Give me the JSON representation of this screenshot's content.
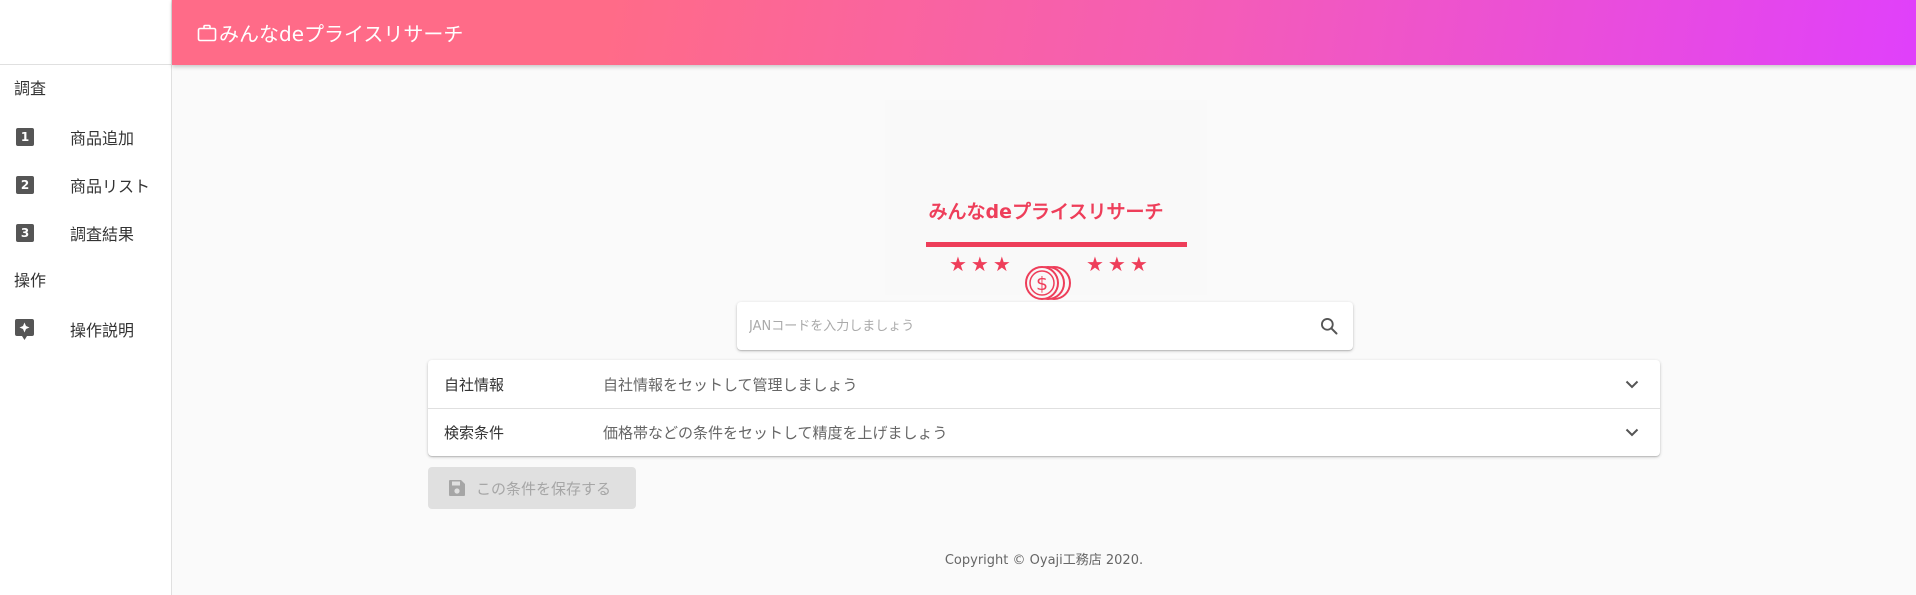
{
  "app": {
    "title": "みんなdeプライスリサーチ"
  },
  "colors": {
    "header_gradient_start": "#ff6b88",
    "header_gradient_end": "#e040fb",
    "brand_red": "#ee3e5a"
  },
  "sidebar": {
    "sections": [
      {
        "label": "調査",
        "items": [
          {
            "icon": "number-1-icon",
            "glyph": "1",
            "label": "商品追加"
          },
          {
            "icon": "number-2-icon",
            "glyph": "2",
            "label": "商品リスト"
          },
          {
            "icon": "number-3-icon",
            "glyph": "3",
            "label": "調査結果"
          }
        ]
      },
      {
        "label": "操作",
        "items": [
          {
            "icon": "help-bubble-icon",
            "label": "操作説明"
          }
        ]
      }
    ]
  },
  "logo": {
    "title": "みんなdeプライスリサーチ",
    "stars_left": "★★★",
    "stars_right": "★★★"
  },
  "search": {
    "placeholder": "JANコードを入力しましょう",
    "value": ""
  },
  "panels": [
    {
      "title": "自社情報",
      "description": "自社情報をセットして管理しましょう"
    },
    {
      "title": "検索条件",
      "description": "価格帯などの条件をセットして精度を上げましょう"
    }
  ],
  "save_button": {
    "label": "この条件を保存する",
    "disabled": true
  },
  "footer": {
    "copyright": "Copyright © Oyaji工務店 2020."
  }
}
